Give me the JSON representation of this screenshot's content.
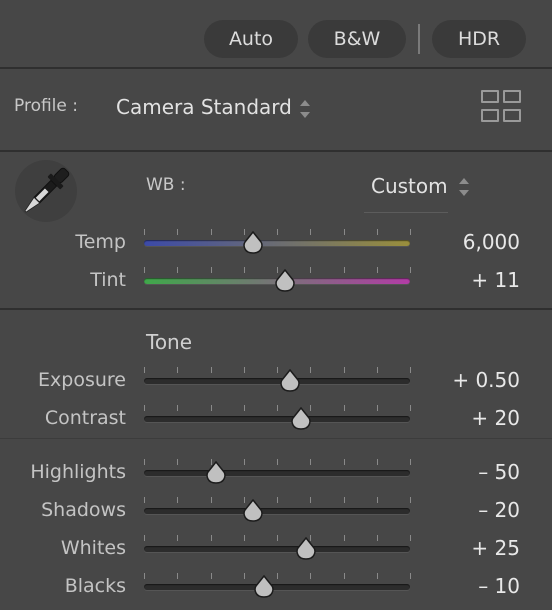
{
  "top_buttons": {
    "auto": "Auto",
    "bw": "B&W",
    "hdr": "HDR"
  },
  "profile": {
    "label": "Profile :",
    "value": "Camera Standard"
  },
  "white_balance": {
    "label": "WB :",
    "value": "Custom",
    "sliders": [
      {
        "key": "temp",
        "label": "Temp",
        "value": "6,000",
        "position": 0.41,
        "gradient": [
          "#3c4aa8",
          "#9a8f3c"
        ]
      },
      {
        "key": "tint",
        "label": "Tint",
        "value": "+ 11",
        "position": 0.53,
        "gradient": [
          "#3fa84a",
          "#b23ca6"
        ]
      }
    ]
  },
  "tone": {
    "heading": "Tone",
    "sliders": [
      {
        "key": "exposure",
        "label": "Exposure",
        "value": "+ 0.50",
        "position": 0.55
      },
      {
        "key": "contrast",
        "label": "Contrast",
        "value": "+ 20",
        "position": 0.59
      },
      {
        "key": "highlights",
        "label": "Highlights",
        "value": "– 50",
        "position": 0.27
      },
      {
        "key": "shadows",
        "label": "Shadows",
        "value": "– 20",
        "position": 0.41
      },
      {
        "key": "whites",
        "label": "Whites",
        "value": "+ 25",
        "position": 0.61
      },
      {
        "key": "blacks",
        "label": "Blacks",
        "value": "– 10",
        "position": 0.45
      }
    ]
  },
  "colors": {
    "background": "#474747",
    "track": "#2c2c2c",
    "thumb": "#c0c0c0"
  }
}
